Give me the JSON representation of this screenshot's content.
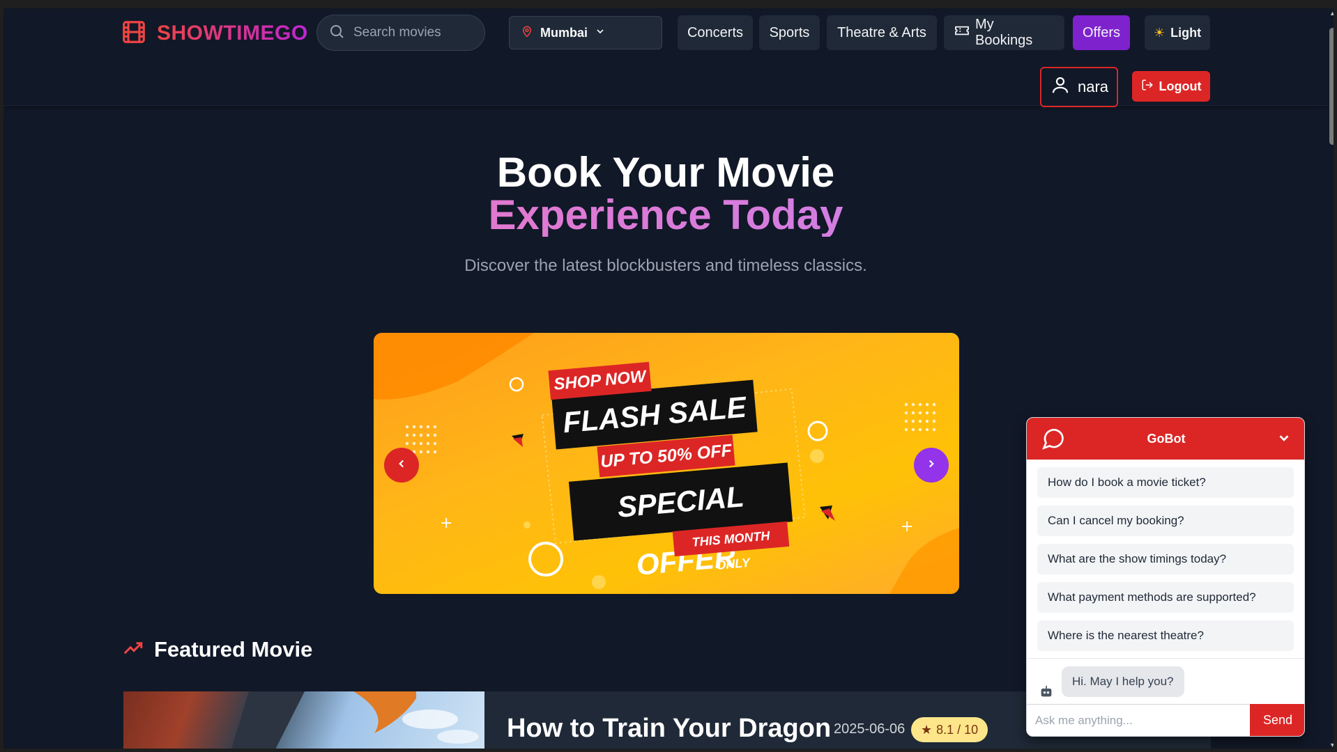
{
  "brand": {
    "name": "SHOWTIMEGO",
    "icon": "film-icon"
  },
  "search": {
    "placeholder": "Search movies",
    "icon": "search-icon"
  },
  "location": {
    "city": "Mumbai",
    "icon": "map-pin-icon"
  },
  "nav": {
    "concerts": "Concerts",
    "sports": "Sports",
    "theatre": "Theatre & Arts",
    "bookings": "My Bookings",
    "offers": "Offers",
    "theme": "Light"
  },
  "user": {
    "name": "nara",
    "logout": "Logout"
  },
  "hero": {
    "title_line1": "Book Your Movie",
    "title_line2": "Experience Today",
    "subtitle": "Discover the latest blockbusters and timeless classics."
  },
  "banner": {
    "shop_now": "SHOP NOW",
    "flash_sale": "FLASH SALE",
    "discount": "UP TO 50% OFF",
    "special_offer": "SPECIAL OFFER",
    "this_month": "THIS MONTH ONLY"
  },
  "featured": {
    "heading": "Featured Movie",
    "movie_title": "How to Train Your Dragon",
    "release_date": "2025-06-06",
    "rating": "8.1 / 10"
  },
  "chat": {
    "title": "GoBot",
    "suggestions": [
      "How do I book a movie ticket?",
      "Can I cancel my booking?",
      "What are the show timings today?",
      "What payment methods are supported?",
      "Where is the nearest theatre?"
    ],
    "bot_message": "Hi. May I help you?",
    "input_placeholder": "Ask me anything...",
    "send": "Send"
  },
  "colors": {
    "brand_red": "#dc2626",
    "offers_purple": "#7e22ce",
    "background": "#111827"
  }
}
